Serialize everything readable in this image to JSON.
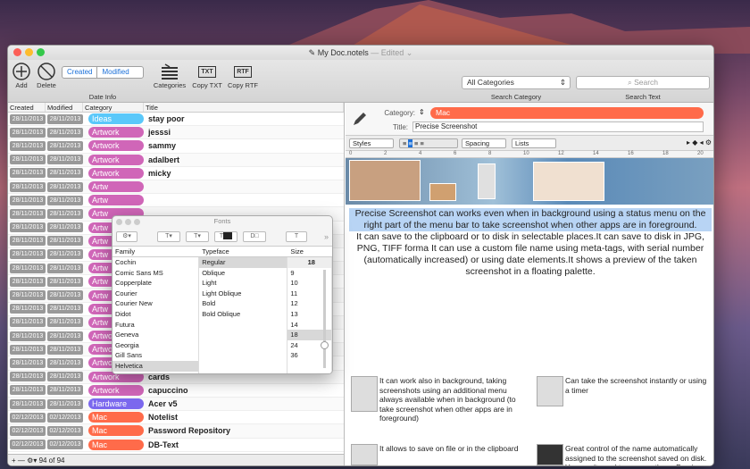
{
  "window": {
    "title": "My Doc.notels",
    "edited": "— Edited ⌄"
  },
  "toolbar": {
    "add": "Add",
    "delete": "Delete",
    "created": "Created",
    "modified": "Modified",
    "date_info": "Date Info",
    "categories": "Categories",
    "copy_txt": "Copy TXT",
    "copy_rtf": "Copy RTF",
    "txt_badge": "TXT",
    "rtf_badge": "RTF",
    "all_categories": "All Categories",
    "search_category": "Search Category",
    "search_placeholder": "Search",
    "search_text": "Search Text"
  },
  "table": {
    "headers": [
      "Created",
      "Modified",
      "Category",
      "Title"
    ],
    "rows": [
      {
        "created": "28/11/2013",
        "modified": "28/11/2013",
        "category": "Ideas",
        "color": "#5ac8fa",
        "title": "stay poor"
      },
      {
        "created": "28/11/2013",
        "modified": "28/11/2013",
        "category": "Artwork",
        "color": "#d066b8",
        "title": "jesssi"
      },
      {
        "created": "28/11/2013",
        "modified": "28/11/2013",
        "category": "Artwork",
        "color": "#d066b8",
        "title": "sammy"
      },
      {
        "created": "28/11/2013",
        "modified": "28/11/2013",
        "category": "Artwork",
        "color": "#d066b8",
        "title": "adalbert"
      },
      {
        "created": "28/11/2013",
        "modified": "28/11/2013",
        "category": "Artwork",
        "color": "#d066b8",
        "title": "micky"
      },
      {
        "created": "28/11/2013",
        "modified": "28/11/2013",
        "category": "Artw",
        "color": "#d066b8",
        "title": ""
      },
      {
        "created": "28/11/2013",
        "modified": "28/11/2013",
        "category": "Artw",
        "color": "#d066b8",
        "title": ""
      },
      {
        "created": "28/11/2013",
        "modified": "28/11/2013",
        "category": "Artw",
        "color": "#d066b8",
        "title": ""
      },
      {
        "created": "28/11/2013",
        "modified": "28/11/2013",
        "category": "Artw",
        "color": "#d066b8",
        "title": ""
      },
      {
        "created": "28/11/2013",
        "modified": "28/11/2013",
        "category": "Artw",
        "color": "#d066b8",
        "title": ""
      },
      {
        "created": "28/11/2013",
        "modified": "28/11/2013",
        "category": "Artw",
        "color": "#d066b8",
        "title": ""
      },
      {
        "created": "28/11/2013",
        "modified": "28/11/2013",
        "category": "Artw",
        "color": "#d066b8",
        "title": ""
      },
      {
        "created": "28/11/2013",
        "modified": "28/11/2013",
        "category": "Artw",
        "color": "#d066b8",
        "title": ""
      },
      {
        "created": "28/11/2013",
        "modified": "28/11/2013",
        "category": "Artw",
        "color": "#d066b8",
        "title": ""
      },
      {
        "created": "28/11/2013",
        "modified": "28/11/2013",
        "category": "Artw",
        "color": "#d066b8",
        "title": ""
      },
      {
        "created": "28/11/2013",
        "modified": "28/11/2013",
        "category": "Artw",
        "color": "#d066b8",
        "title": ""
      },
      {
        "created": "28/11/2013",
        "modified": "28/11/2013",
        "category": "Artwork",
        "color": "#d066b8",
        "title": "milk"
      },
      {
        "created": "28/11/2013",
        "modified": "28/11/2013",
        "category": "Artwork",
        "color": "#d066b8",
        "title": "rocket"
      },
      {
        "created": "28/11/2013",
        "modified": "28/11/2013",
        "category": "Artwork",
        "color": "#d066b8",
        "title": "sea"
      },
      {
        "created": "28/11/2013",
        "modified": "28/11/2013",
        "category": "Artwork",
        "color": "#d066b8",
        "title": "cards"
      },
      {
        "created": "28/11/2013",
        "modified": "28/11/2013",
        "category": "Artwork",
        "color": "#d066b8",
        "title": "capuccino"
      },
      {
        "created": "28/11/2013",
        "modified": "28/11/2013",
        "category": "Hardware",
        "color": "#7b68ee",
        "title": "Acer v5"
      },
      {
        "created": "02/12/2013",
        "modified": "02/12/2013",
        "category": "Mac",
        "color": "#ff6b4a",
        "title": "Notelist"
      },
      {
        "created": "02/12/2013",
        "modified": "02/12/2013",
        "category": "Mac",
        "color": "#ff6b4a",
        "title": "Password Repository"
      },
      {
        "created": "02/12/2013",
        "modified": "02/12/2013",
        "category": "Mac",
        "color": "#ff6b4a",
        "title": "DB-Text"
      }
    ],
    "footer": "94 of 94"
  },
  "editor": {
    "category_label": "Category:",
    "category_value": "Mac",
    "title_label": "Title:",
    "title_value": "Precise Screenshot",
    "styles": "Styles",
    "spacing": "Spacing",
    "lists": "Lists",
    "ruler_marks": [
      "0",
      "2",
      "4",
      "6",
      "8",
      "10",
      "12",
      "14",
      "16",
      "18",
      "20"
    ],
    "para1": "Precise Screenshot can works even when in background using a status menu on the right part of the menu bar to take screenshot when other apps are in foreground.",
    "para2": "It can save to the clipboard or to disk in selectable places.It can save to disk in JPG, PNG, TIFF forma It can use a custom file name using meta-tags, with serial number (automatically increased) or using date elements.It shows a preview of the taken screenshot in a floating palette.",
    "feat1": "It can work also in background, taking screenshots using an additional menu always available when in background (to take screenshot when other apps are in foreground)",
    "feat2": "Can take the screenshot instantly or using a timer",
    "feat3": "It allows to save on file or in the clipboard",
    "feat4": "Great control of the name automatically assigned to the screenshot saved on disk. You won't need to rename them. Precise Screenshot assign them the name you really need to work."
  },
  "fonts_panel": {
    "title": "Fonts",
    "headers": [
      "Family",
      "Typeface",
      "Size"
    ],
    "size_value": "18",
    "families": [
      "Cochin",
      "Comic Sans MS",
      "Copperplate",
      "Courier",
      "Courier New",
      "Didot",
      "Futura",
      "Geneva",
      "Georgia",
      "Gill Sans",
      "Helvetica"
    ],
    "typefaces": [
      "Regular",
      "Oblique",
      "Light",
      "Light Oblique",
      "Bold",
      "Bold Oblique"
    ],
    "sizes": [
      "9",
      "10",
      "11",
      "12",
      "13",
      "14",
      "18",
      "24",
      "36"
    ]
  }
}
